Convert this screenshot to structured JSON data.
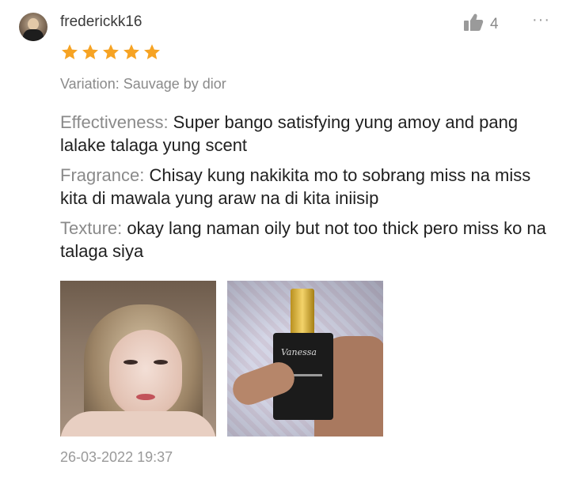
{
  "review": {
    "username": "frederickk16",
    "rating": 5,
    "max_rating": 5,
    "star_color": "#f6a323",
    "likes": "4",
    "more_label": "···",
    "variation": "Variation: Sauvage by dior",
    "attributes": [
      {
        "key": "Effectiveness:",
        "value": " Super bango satisfying yung amoy and pang lalake talaga yung scent"
      },
      {
        "key": "Fragrance:",
        "value": " Chisay kung nakikita mo to sobrang miss na miss kita di mawala yung araw na di kita iniisip"
      },
      {
        "key": "Texture:",
        "value": " okay lang naman oily but not too thick pero miss ko na talaga siya"
      }
    ],
    "timestamp": "26-03-2022 19:37"
  }
}
